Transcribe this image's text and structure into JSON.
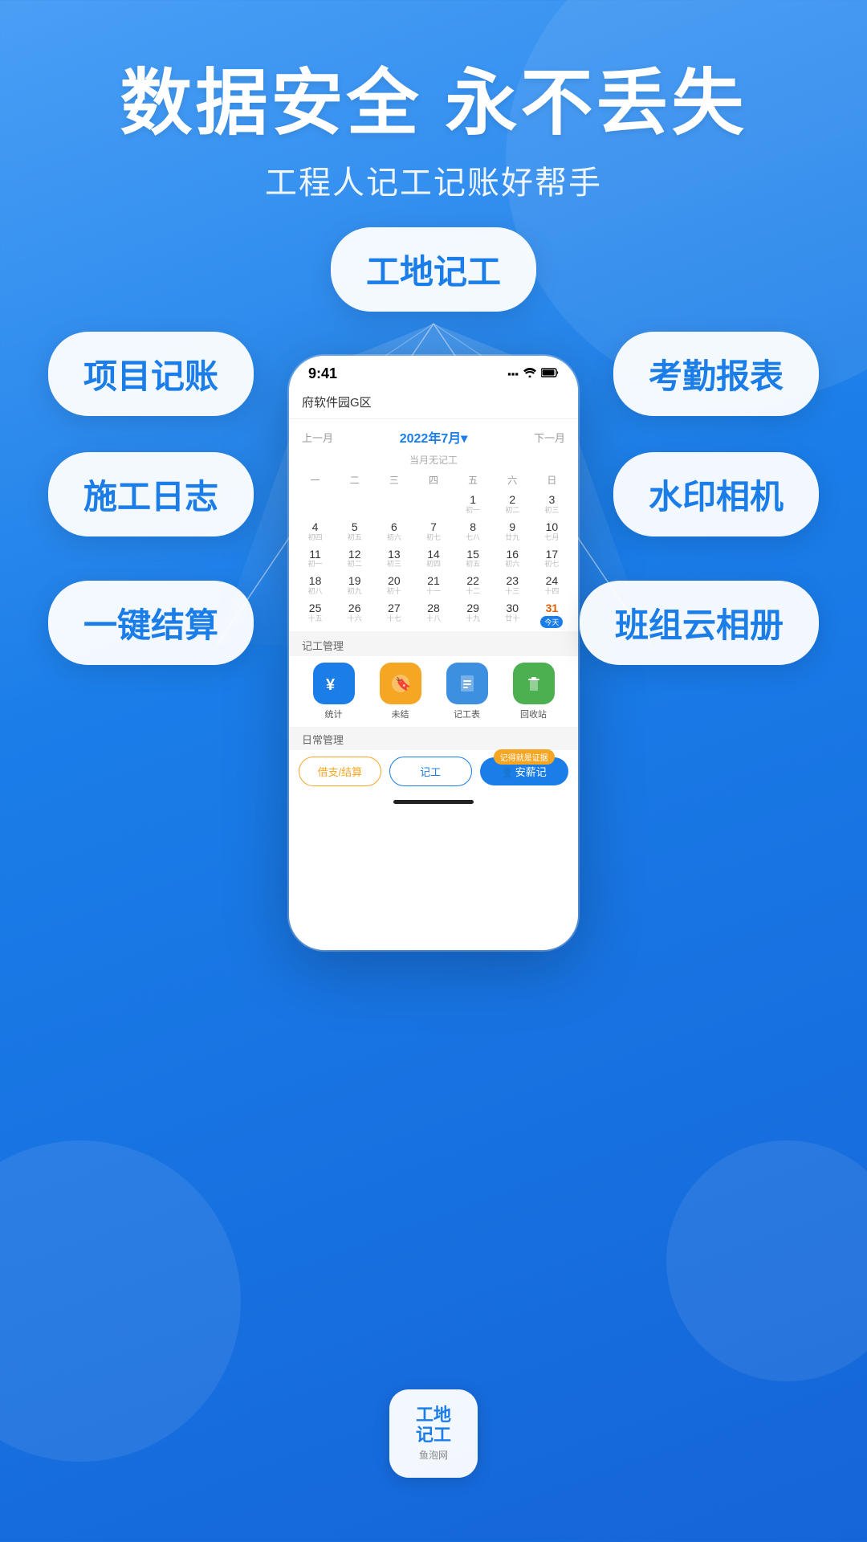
{
  "background": {
    "gradient_start": "#4a9ff5",
    "gradient_end": "#1565d8"
  },
  "header": {
    "main_title": "数据安全 永不丢失",
    "subtitle": "工程人记工记账好帮手"
  },
  "feature_cards": {
    "center": "工地记工",
    "left1": "项目记账",
    "right1": "考勤报表",
    "left2": "施工日志",
    "right2": "水印相机",
    "left3": "一键结算",
    "right3": "班组云相册"
  },
  "phone": {
    "status_bar": {
      "time": "9:41",
      "signal": "▪▪▪",
      "wifi": "wifi",
      "battery": "▭"
    },
    "location": "府软件园G区",
    "calendar": {
      "prev_label": "上一月",
      "next_label": "下一月",
      "title": "2022年7月▾",
      "no_record": "当月无记工",
      "weekdays": [
        "一",
        "二",
        "三",
        "四",
        "五",
        "六",
        "日"
      ],
      "rows": [
        [
          {
            "num": "",
            "lunar": ""
          },
          {
            "num": "",
            "lunar": ""
          },
          {
            "num": "",
            "lunar": ""
          },
          {
            "num": "",
            "lunar": ""
          },
          {
            "num": "1",
            "lunar": "初一"
          },
          {
            "num": "2",
            "lunar": "初二"
          },
          {
            "num": "3",
            "lunar": "初三"
          }
        ],
        [
          {
            "num": "4",
            "lunar": "初四"
          },
          {
            "num": "5",
            "lunar": "初五"
          },
          {
            "num": "6",
            "lunar": "初六"
          },
          {
            "num": "7",
            "lunar": "初七"
          },
          {
            "num": "8",
            "lunar": "七八"
          },
          {
            "num": "9",
            "lunar": "廿九"
          },
          {
            "num": "10",
            "lunar": "七月"
          }
        ],
        [
          {
            "num": "11",
            "lunar": "初一"
          },
          {
            "num": "12",
            "lunar": "初二"
          },
          {
            "num": "13",
            "lunar": "初三"
          },
          {
            "num": "14",
            "lunar": "初四"
          },
          {
            "num": "15",
            "lunar": "初五"
          },
          {
            "num": "16",
            "lunar": "初六"
          },
          {
            "num": "17",
            "lunar": "初七"
          }
        ],
        [
          {
            "num": "18",
            "lunar": "初八"
          },
          {
            "num": "19",
            "lunar": "初九"
          },
          {
            "num": "20",
            "lunar": "初十"
          },
          {
            "num": "21",
            "lunar": "十一"
          },
          {
            "num": "22",
            "lunar": "十二"
          },
          {
            "num": "23",
            "lunar": "十三"
          },
          {
            "num": "24",
            "lunar": "十四"
          }
        ],
        [
          {
            "num": "25",
            "lunar": "十五"
          },
          {
            "num": "26",
            "lunar": "十六"
          },
          {
            "num": "27",
            "lunar": "十七"
          },
          {
            "num": "28",
            "lunar": "十八"
          },
          {
            "num": "29",
            "lunar": "十九"
          },
          {
            "num": "30",
            "lunar": "廿十"
          },
          {
            "num": "31",
            "lunar": "今天",
            "today": true
          }
        ]
      ]
    },
    "section1": {
      "title": "记工管理",
      "icons": [
        {
          "label": "统计",
          "color": "blue",
          "emoji": "¥"
        },
        {
          "label": "未结",
          "color": "orange",
          "emoji": "🔖"
        },
        {
          "label": "记工表",
          "color": "blue2",
          "emoji": "📋"
        },
        {
          "label": "回收站",
          "color": "green",
          "emoji": "🗑"
        }
      ]
    },
    "section2": {
      "title": "日常管理"
    },
    "bottom_bar": {
      "btn1": "借支/结算",
      "btn2": "记工",
      "btn3": "安薪记",
      "badge": "记得就是证据"
    }
  },
  "app_icon": {
    "line1": "工地",
    "line2": "记工",
    "subtext": "鱼泡网"
  }
}
